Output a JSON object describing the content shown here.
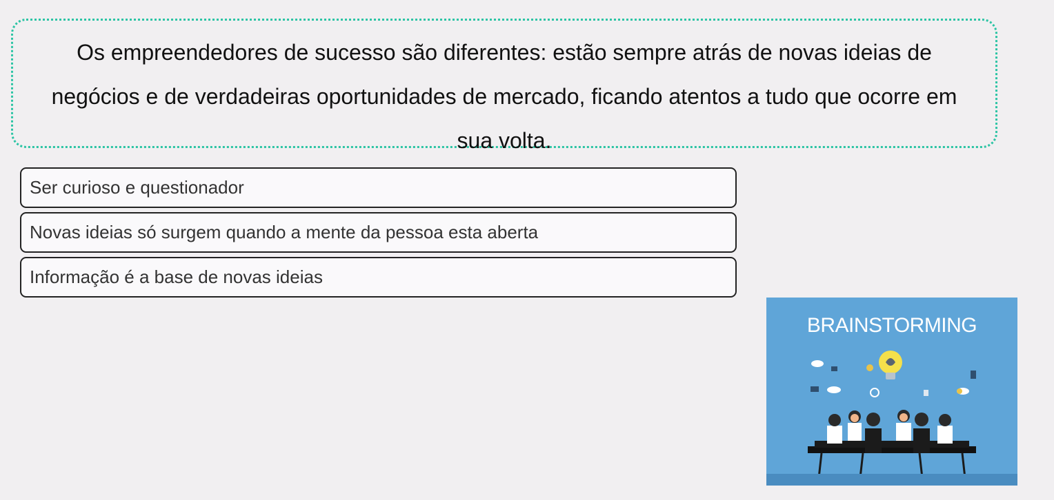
{
  "quote": {
    "text": "Os empreendedores de sucesso são diferentes: estão sempre atrás de novas ideias de negócios e de verdadeiras oportunidades de mercado, ficando atentos a tudo que ocorre em sua volta."
  },
  "options": [
    {
      "label": "Ser curioso e questionador"
    },
    {
      "label": "Novas ideias só surgem quando a mente da pessoa esta aberta"
    },
    {
      "label": "Informação é a base de novas ideias"
    }
  ],
  "illustration": {
    "title": "BRAINSTORMING",
    "background_color": "#5fa5d8",
    "icons": [
      "lightbulb-icon",
      "brain-icon",
      "cloud-icon",
      "clock-icon",
      "people-at-table-icon"
    ]
  },
  "colors": {
    "quote_border": "#2bc4a4",
    "page_background": "#f1eff1"
  }
}
